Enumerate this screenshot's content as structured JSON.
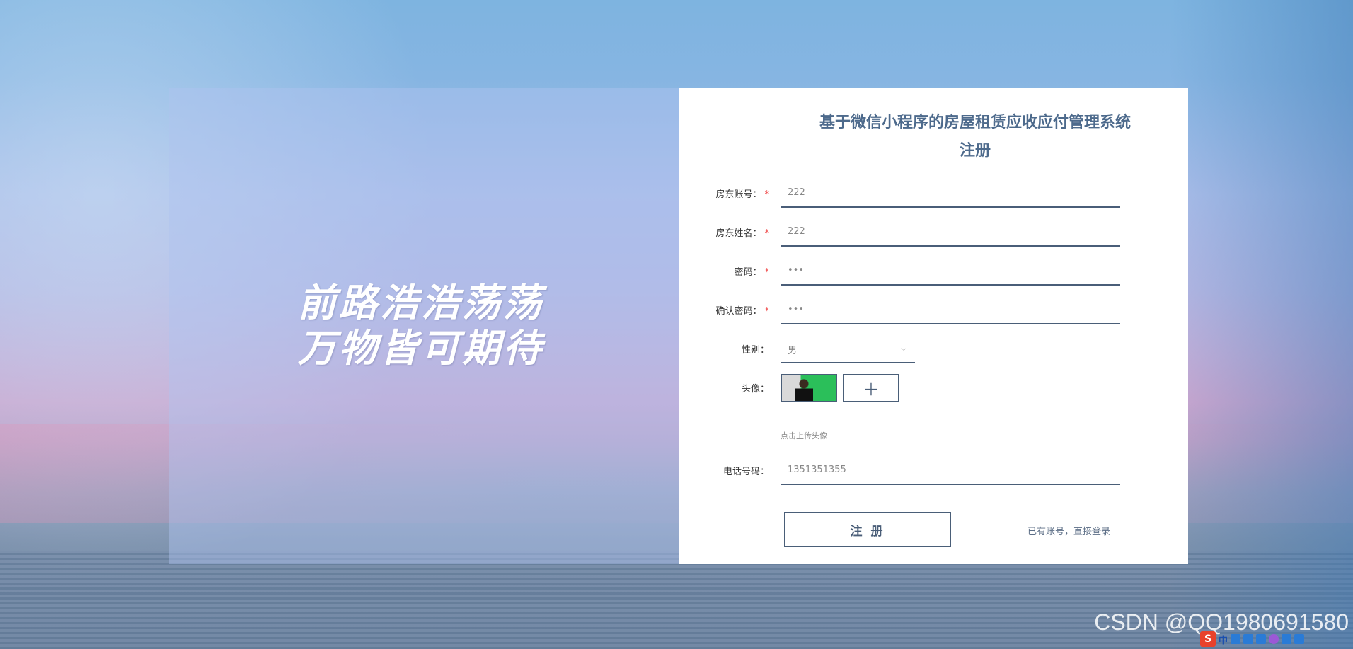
{
  "slogan": {
    "line1": "前路浩浩荡荡",
    "line2": "万物皆可期待"
  },
  "form": {
    "title_line1": "基于微信小程序的房屋租赁应收应付管理系统",
    "title_line2": "注册",
    "fields": {
      "account": {
        "label": "房东账号：",
        "required": "*",
        "value": "222"
      },
      "name": {
        "label": "房东姓名：",
        "required": "*",
        "value": "222"
      },
      "password": {
        "label": "密码：",
        "required": "*",
        "value": "•••"
      },
      "confirm_password": {
        "label": "确认密码：",
        "required": "*",
        "value": "•••"
      },
      "gender": {
        "label": "性别：",
        "value": "男"
      },
      "avatar": {
        "label": "头像：",
        "add_symbol": "+"
      },
      "phone": {
        "label": "电话号码：",
        "value": "1351351355"
      }
    },
    "avatar_hint": "点击上传头像",
    "submit_label": "注 册",
    "login_link": "已有账号，直接登录"
  },
  "watermark": "CSDN @QQ1980691580",
  "tray": {
    "ime_label": "中",
    "ime_logo": "S"
  }
}
